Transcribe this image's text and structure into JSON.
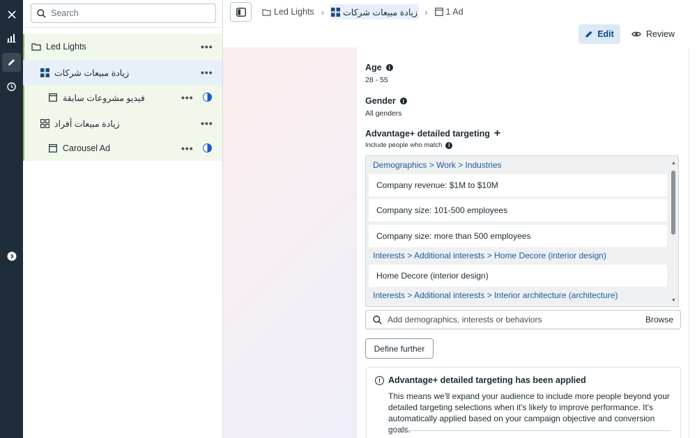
{
  "search": {
    "placeholder": "Search"
  },
  "tree": {
    "campaign": {
      "label": "Led Lights"
    },
    "adsets": [
      {
        "label": "زيادة مبيعات شركات",
        "ads": [
          {
            "label": "فيديو مشروعات سابقة"
          }
        ]
      },
      {
        "label": "زيادة مبيعات أفراد",
        "ads": [
          {
            "label": "Carousel Ad"
          }
        ]
      }
    ]
  },
  "breadcrumb": {
    "campaign": "Led Lights",
    "adset": "زيادة مبيعات شركات",
    "ad": "1 Ad"
  },
  "toolbar": {
    "edit_label": "Edit",
    "review_label": "Review"
  },
  "age": {
    "title": "Age",
    "value": "28 - 55"
  },
  "gender": {
    "title": "Gender",
    "value": "All genders"
  },
  "targeting": {
    "title": "Advantage+ detailed targeting",
    "subtitle": "Include people who match",
    "groups": [
      {
        "category": "Demographics > Work > Industries",
        "items": [
          "Company revenue: $1M to $10M",
          "Company size: 101-500 employees",
          "Company size: more than 500 employees"
        ]
      },
      {
        "category": "Interests > Additional interests > Home Decore (interior design)",
        "items": [
          "Home Decore (interior design)"
        ]
      },
      {
        "category": "Interests > Additional interests > Interior architecture (architecture)",
        "items": []
      }
    ],
    "add_placeholder": "Add demographics, interests or behaviors",
    "browse_label": "Browse",
    "define_label": "Define further"
  },
  "notice": {
    "title": "Advantage+ detailed targeting has been applied",
    "body": "This means we'll expand your audience to include more people beyond your detailed targeting selections when it's likely to improve performance. It's automatically applied based on your campaign objective and conversion goals."
  },
  "colors": {
    "rail": "#1f2d3a",
    "link": "#1c5a9c",
    "accent": "#1a5cc8",
    "selected_row": "#e7eff8",
    "active_branch": "#f1f7ea"
  }
}
